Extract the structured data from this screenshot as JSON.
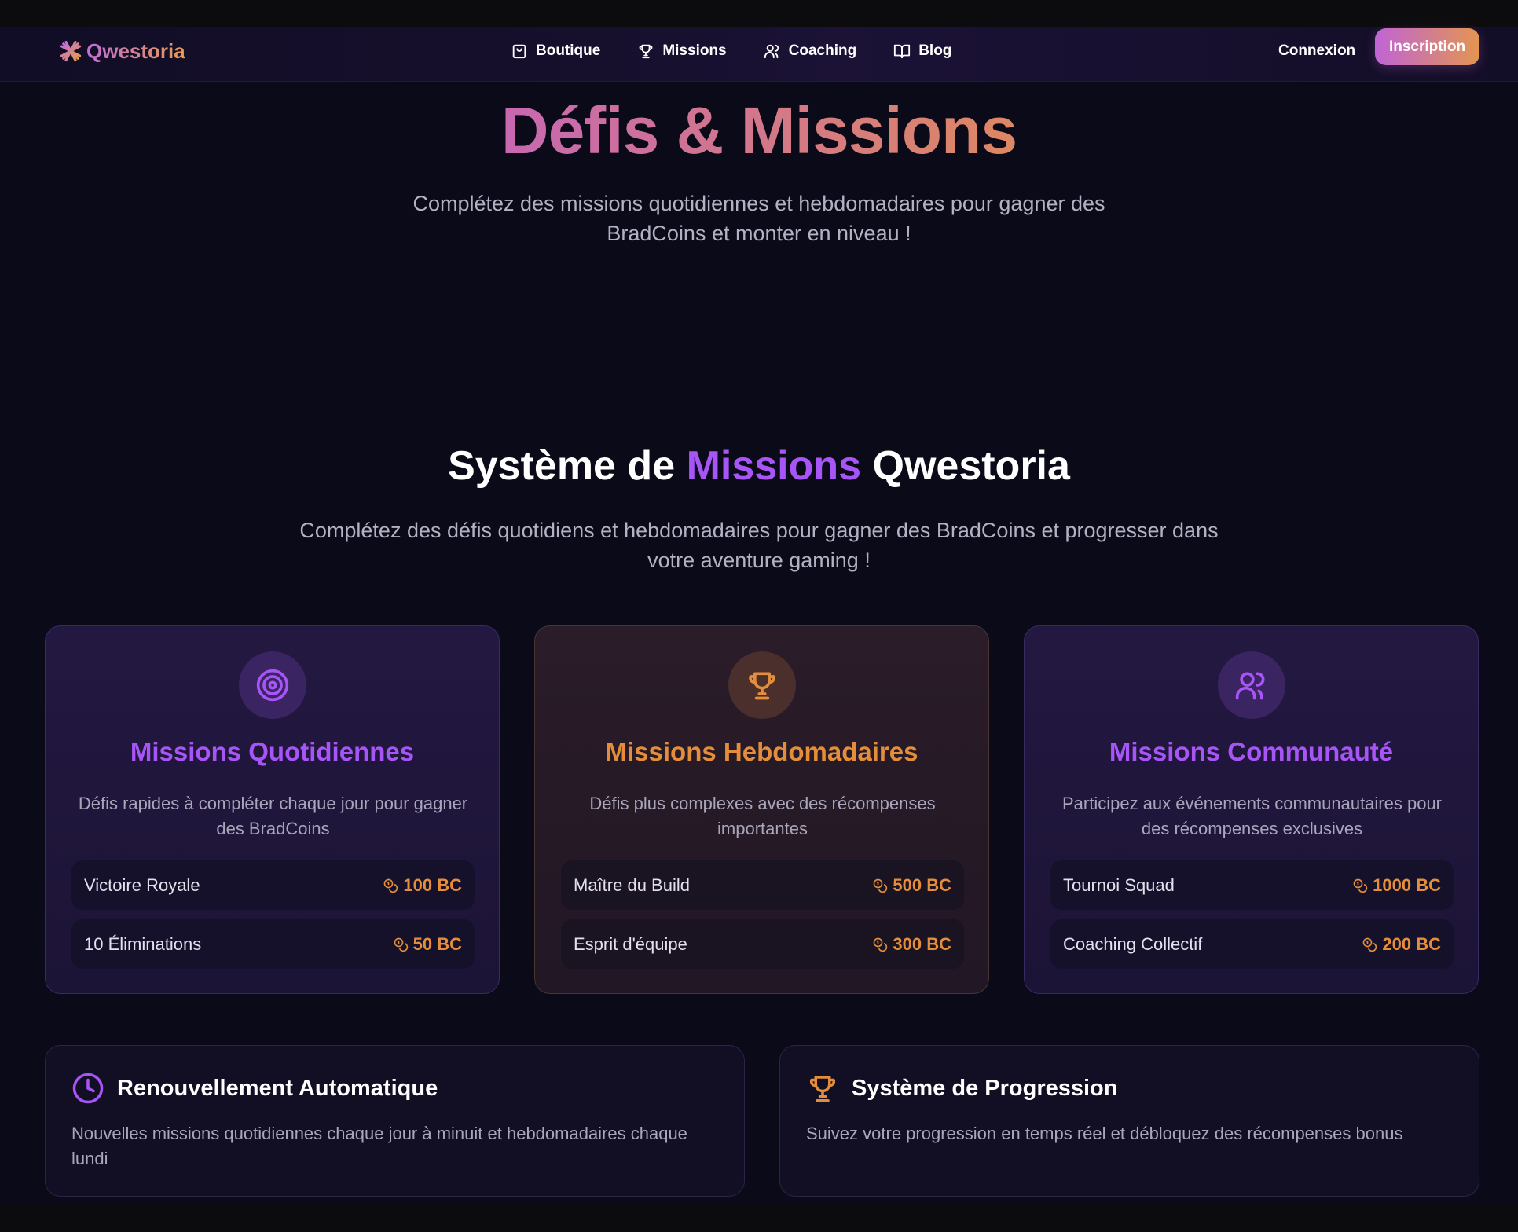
{
  "nav": {
    "logo_text": "Qwestoria",
    "links": [
      {
        "label": "Boutique",
        "icon": "shopping-bag-icon"
      },
      {
        "label": "Missions",
        "icon": "trophy-icon"
      },
      {
        "label": "Coaching",
        "icon": "users-icon"
      },
      {
        "label": "Blog",
        "icon": "book-icon"
      }
    ],
    "login_label": "Connexion",
    "signup_label": "Inscription"
  },
  "hero": {
    "title": "Défis & Missions",
    "subtitle": "Complétez des missions quotidiennes et hebdomadaires pour gagner des BradCoins et monter en niveau !"
  },
  "section": {
    "title_part1": "Système de ",
    "title_accent": "Missions",
    "title_part2": " Qwestoria",
    "subtitle": "Complétez des défis quotidiens et hebdomadaires pour gagner des BradCoins et progresser dans votre aventure gaming !"
  },
  "cards": [
    {
      "icon": "target-icon",
      "title": "Missions Quotidiennes",
      "description": "Défis rapides à compléter chaque jour pour gagner des BradCoins",
      "missions": [
        {
          "name": "Victoire Royale",
          "reward": "100 BC"
        },
        {
          "name": "10 Éliminations",
          "reward": "50 BC"
        }
      ]
    },
    {
      "icon": "trophy-icon",
      "title": "Missions Hebdomadaires",
      "description": "Défis plus complexes avec des récompenses importantes",
      "missions": [
        {
          "name": "Maître du Build",
          "reward": "500 BC"
        },
        {
          "name": "Esprit d'équipe",
          "reward": "300 BC"
        }
      ]
    },
    {
      "icon": "users-icon",
      "title": "Missions Communauté",
      "description": "Participez aux événements communautaires pour des récompenses exclusives",
      "missions": [
        {
          "name": "Tournoi Squad",
          "reward": "1000 BC"
        },
        {
          "name": "Coaching Collectif",
          "reward": "200 BC"
        }
      ]
    }
  ],
  "info_boxes": [
    {
      "icon": "clock-icon",
      "title": "Renouvellement Automatique",
      "description": "Nouvelles missions quotidiennes chaque jour à minuit et hebdomadaires chaque lundi"
    },
    {
      "icon": "trophy-icon",
      "title": "Système de Progression",
      "description": "Suivez votre progression en temps réel et débloquez des récompenses bonus"
    }
  ],
  "colors": {
    "background": "#0b0a18",
    "purple_accent": "#a855f7",
    "orange_accent": "#e48d3a",
    "gradient_start": "#c064d6",
    "gradient_end": "#e39550"
  }
}
